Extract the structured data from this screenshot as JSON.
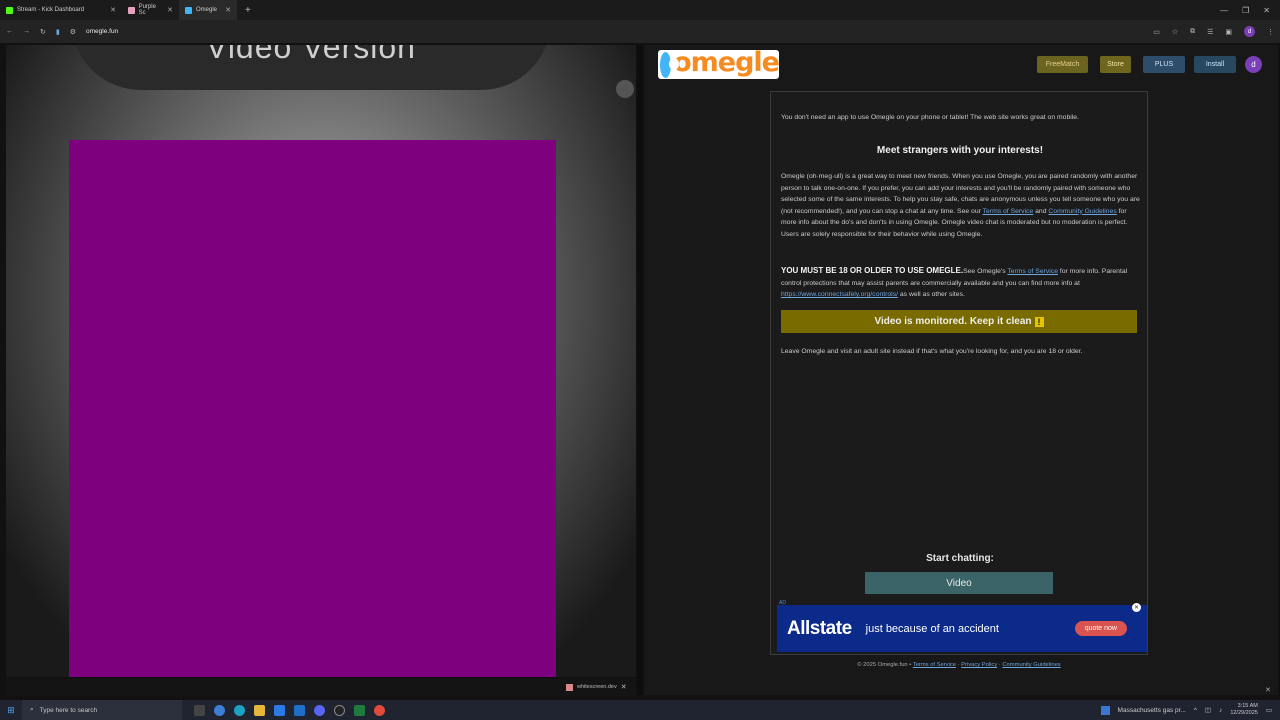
{
  "browser": {
    "tabs": [
      {
        "label": "Stream - Kick Dashboard",
        "favicon_color": "#53fc18"
      },
      {
        "label": "Purple Sc",
        "favicon_color": "#e8a0c0"
      },
      {
        "label": "Omegle",
        "favicon_color": "#42b6f5"
      }
    ],
    "url": "omegle.fun"
  },
  "left": {
    "heading": "Video Version",
    "panel_color": "#7f007f",
    "download_label": "whitescreen.dev"
  },
  "omegle": {
    "logo_text": "omegle",
    "nav": {
      "freematch": "FreeMatch",
      "store": "Store",
      "plus": "PLUS",
      "install": "Install",
      "avatar": "d"
    },
    "mobile_note": "You don't need an app to use Omegle on your phone or tablet! The web site works great on mobile.",
    "heading": "Meet strangers with your interests!",
    "desc_1": "Omegle (oh·meg·ull) is a great way to meet new friends. When you use Omegle, you are paired randomly with another person to talk one-on-one. If you prefer, you can add your interests and you'll be randomly paired with someone who selected some of the same interests. To help you stay safe, chats are anonymous unless you tell someone who you are (not recommended!), and you can stop a chat at any time. See our",
    "desc_tos": "Terms of Service",
    "desc_and": "and",
    "desc_cg": "Community Guidelines",
    "desc_2": "for more info about the do's and don'ts in using Omegle. Omegle video chat is moderated but no moderation is perfect. Users are solely responsible for their behavior while using Omegle.",
    "warn_bold": "YOU MUST BE 18 OR OLDER TO USE OMEGLE.",
    "warn_1": "See Omegle's",
    "warn_tos": "Terms of Service",
    "warn_2": "for more info. Parental control protections that may assist parents are commercially available and you can find more info at",
    "warn_link": "https://www.connectsafely.org/controls/",
    "warn_3": "as well as other sites.",
    "monitored": "Video is monitored. Keep it clean",
    "monitored_icon": "!",
    "adult_note": "Leave Omegle and visit an adult site instead if that's what you're looking for, and you are 18 or older.",
    "start_label": "Start chatting:",
    "video_button": "Video",
    "ad": {
      "label": "AD",
      "brand": "Allstate",
      "tagline": "just because of an accident",
      "cta": "quote now"
    },
    "footer": {
      "copyright": "© 2025 Omegle.fun •",
      "tos": "Terms of Service",
      "privacy": "Privacy Policy",
      "guidelines": "Community Guidelines"
    }
  },
  "taskbar": {
    "search_placeholder": "Type here to search",
    "news": "Massachusetts gas pr...",
    "time": "3:15 AM",
    "date": "12/29/2025"
  }
}
